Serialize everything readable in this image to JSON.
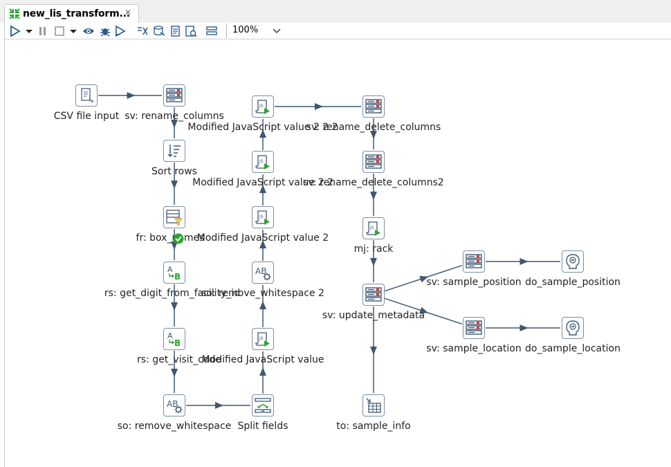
{
  "tab": {
    "title": "new_lis_transform...",
    "close": "✕"
  },
  "toolbar": {
    "icons": [
      "run-icon",
      "run-dropdown-icon",
      "pause-icon",
      "stop-icon",
      "stop-dropdown-icon",
      "preview-icon",
      "debug-icon",
      "replay-icon",
      "verify-icon",
      "impact-analysis-icon",
      "sql-icon",
      "explore-db-icon",
      "show-results-icon",
      "align-icon"
    ],
    "zoom": "100%"
  },
  "steps": [
    {
      "id": "csv_input",
      "label": "CSV file input",
      "icon": "csv-file-input-icon"
    },
    {
      "id": "rename_cols",
      "label": "sv: rename_columns",
      "icon": "select-values-icon"
    },
    {
      "id": "sort_rows",
      "label": "Sort rows",
      "icon": "sort-rows-icon"
    },
    {
      "id": "box_names",
      "label": "fr: box_names",
      "icon": "filter-rows-icon"
    },
    {
      "id": "get_digit",
      "label": "rs: get_digit_from_facility_id",
      "icon": "replace-string-icon"
    },
    {
      "id": "visit_code",
      "label": "rs: get_visit_code",
      "icon": "replace-string-icon"
    },
    {
      "id": "so_remove",
      "label": "so: remove_whitespace",
      "icon": "string-operations-icon"
    },
    {
      "id": "split",
      "label": "Split fields",
      "icon": "split-fields-icon"
    },
    {
      "id": "mjv",
      "label": "Modified JavaScript value",
      "icon": "javascript-icon"
    },
    {
      "id": "so_remove2",
      "label": "so: remove_whitespace 2",
      "icon": "string-operations-icon"
    },
    {
      "id": "mjv2",
      "label": "Modified JavaScript value 2",
      "icon": "javascript-icon"
    },
    {
      "id": "mjv22",
      "label": "Modified JavaScript value 2 2",
      "icon": "javascript-icon"
    },
    {
      "id": "mjv222",
      "label": "Modified JavaScript value 2 2 2",
      "icon": "javascript-icon"
    },
    {
      "id": "rename_del",
      "label": "sv: rename_delete_columns",
      "icon": "select-values-icon"
    },
    {
      "id": "rename_del2",
      "label": "sv: rename_delete_columns2",
      "icon": "select-values-icon"
    },
    {
      "id": "rack",
      "label": "mj: rack",
      "icon": "javascript-icon"
    },
    {
      "id": "upd_meta",
      "label": "sv: update_metadata",
      "icon": "select-values-icon"
    },
    {
      "id": "s_position",
      "label": "sv: sample_position",
      "icon": "select-values-icon"
    },
    {
      "id": "s_location",
      "label": "sv: sample_location",
      "icon": "select-values-icon"
    },
    {
      "id": "do_position",
      "label": "do_sample_position",
      "icon": "data-output-icon"
    },
    {
      "id": "do_location",
      "label": "do_sample_location",
      "icon": "data-output-icon"
    },
    {
      "id": "sample_info",
      "label": "to: sample_info",
      "icon": "table-output-icon"
    }
  ],
  "colors": {
    "hop": "#3f5872",
    "step_border": "#7c8ea5",
    "accent_red": "#cc2222",
    "accent_green": "#2aa52a"
  }
}
